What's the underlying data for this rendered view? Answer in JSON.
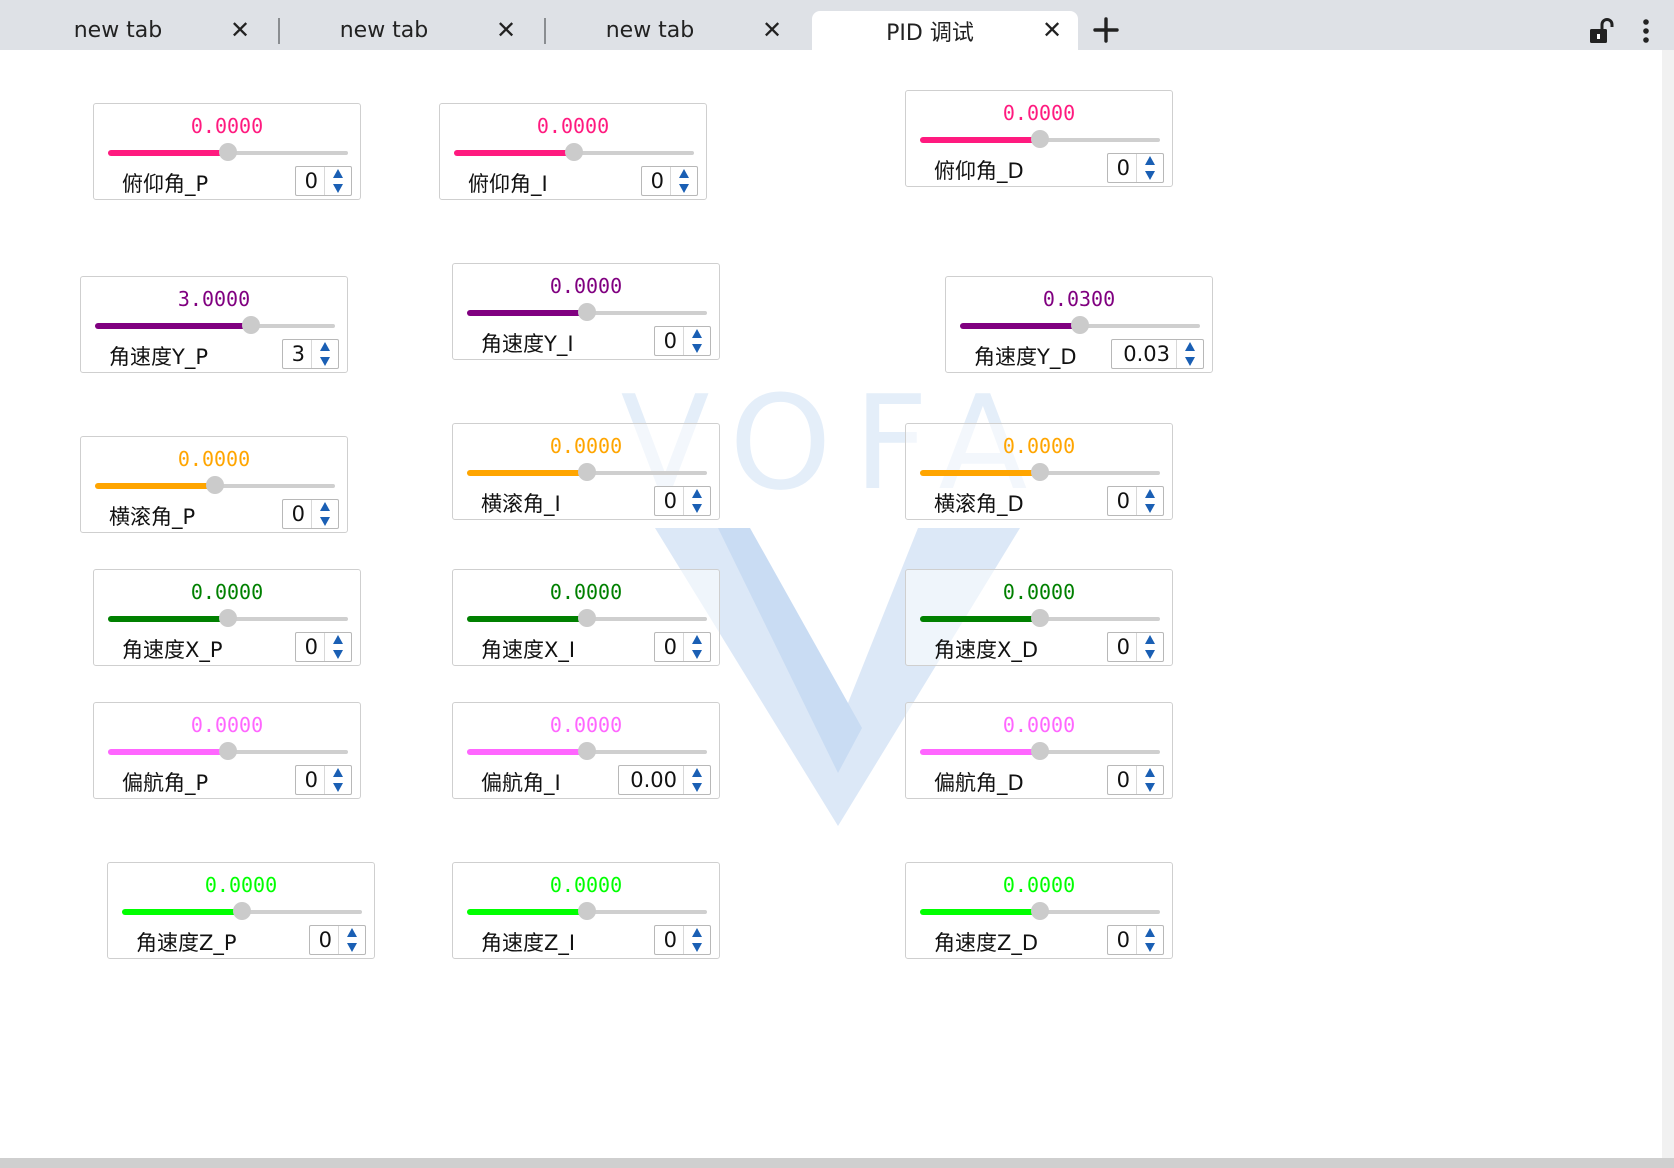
{
  "tabs": [
    {
      "label": "new tab",
      "close": "✕",
      "active": false
    },
    {
      "label": "new tab",
      "close": "✕",
      "active": false
    },
    {
      "label": "new tab",
      "close": "✕",
      "active": false
    },
    {
      "label": "PID 调试",
      "close": "✕",
      "active": true
    }
  ],
  "toolbar": {
    "new_tab_icon": "plus-icon",
    "lock_icon": "unlock-icon",
    "menu_icon": "more-vertical-icon"
  },
  "watermark": {
    "text": "VOFA"
  },
  "slider_min": -3,
  "slider_max": 3,
  "controls": [
    {
      "label": "俯仰角_P",
      "value": "0.0000",
      "input": "0",
      "color": "#ff1a7f",
      "level": 0.5
    },
    {
      "label": "俯仰角_I",
      "value": "0.0000",
      "input": "0",
      "color": "#ff1a7f",
      "level": 0.5
    },
    {
      "label": "俯仰角_D",
      "value": "0.0000",
      "input": "0",
      "color": "#ff1a7f",
      "level": 0.5
    },
    {
      "label": "角速度Y_P",
      "value": "3.0000",
      "input": "3",
      "color": "#800080",
      "level": 0.65
    },
    {
      "label": "角速度Y_I",
      "value": "0.0000",
      "input": "0",
      "color": "#800080",
      "level": 0.5
    },
    {
      "label": "角速度Y_D",
      "value": "0.0300",
      "input": "0.03",
      "color": "#800080",
      "level": 0.5
    },
    {
      "label": "横滚角_P",
      "value": "0.0000",
      "input": "0",
      "color": "#ffa500",
      "level": 0.5
    },
    {
      "label": "横滚角_I",
      "value": "0.0000",
      "input": "0",
      "color": "#ffa500",
      "level": 0.5
    },
    {
      "label": "横滚角_D",
      "value": "0.0000",
      "input": "0",
      "color": "#ffa500",
      "level": 0.5
    },
    {
      "label": "角速度X_P",
      "value": "0.0000",
      "input": "0",
      "color": "#008000",
      "level": 0.5
    },
    {
      "label": "角速度X_I",
      "value": "0.0000",
      "input": "0",
      "color": "#008000",
      "level": 0.5
    },
    {
      "label": "角速度X_D",
      "value": "0.0000",
      "input": "0",
      "color": "#008000",
      "level": 0.5
    },
    {
      "label": "偏航角_P",
      "value": "0.0000",
      "input": "0",
      "color": "#ff66ff",
      "level": 0.5
    },
    {
      "label": "偏航角_I",
      "value": "0.0000",
      "input": "0.00",
      "color": "#ff66ff",
      "level": 0.5
    },
    {
      "label": "偏航角_D",
      "value": "0.0000",
      "input": "0",
      "color": "#ff66ff",
      "level": 0.5
    },
    {
      "label": "角速度Z_P",
      "value": "0.0000",
      "input": "0",
      "color": "#00ff00",
      "level": 0.5
    },
    {
      "label": "角速度Z_I",
      "value": "0.0000",
      "input": "0",
      "color": "#00ff00",
      "level": 0.5
    },
    {
      "label": "角速度Z_D",
      "value": "0.0000",
      "input": "0",
      "color": "#00ff00",
      "level": 0.5
    }
  ]
}
